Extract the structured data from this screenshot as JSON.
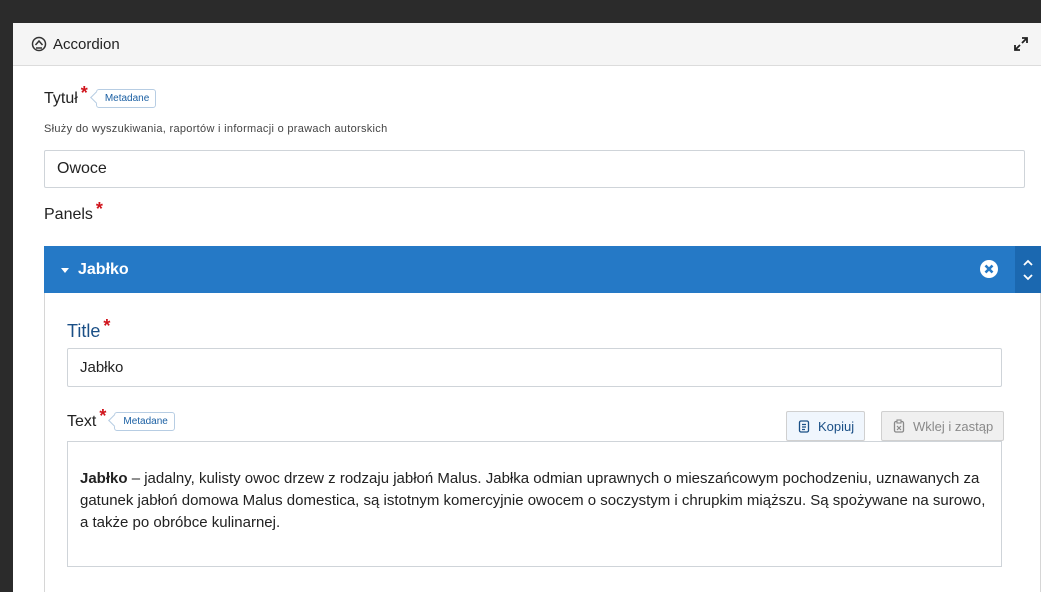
{
  "header": {
    "title": "Accordion",
    "icon": "library-icon",
    "expand_icon": "expand-icon"
  },
  "title_field": {
    "label": "Tytuł",
    "required_mark": "*",
    "tag": "Metadane",
    "description": "Służy do wyszukiwania, raportów i informacji o prawach autorskich",
    "value": "Owoce"
  },
  "panels_label": "Panels",
  "panels_required": "*",
  "panel": {
    "title": "Jabłko",
    "header_color": "#2579c6",
    "title_field": {
      "label": "Title",
      "required_mark": "*",
      "value": "Jabłko"
    },
    "text_field": {
      "label": "Text",
      "required_mark": "*",
      "tag": "Metadane",
      "copy_label": "Kopiuj",
      "paste_label": "Wklej i zastąp",
      "bold_term": "Jabłko",
      "body": " – jadalny, kulisty owoc drzew z rodzaju jabłoń Malus. Jabłka odmian uprawnych o mieszańcowym pochodzeniu, uznawanych za gatunek jabłoń domowa Malus domestica, są istotnym komercyjnie owocem o soczystym i chrupkim miąższu. Są spożywane na surowo, a także po obróbce kulinarnej."
    }
  }
}
